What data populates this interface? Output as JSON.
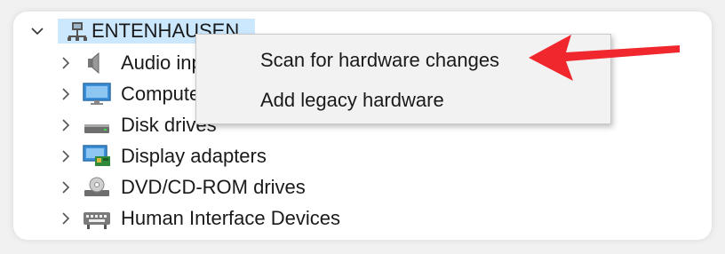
{
  "device_manager": {
    "root": {
      "label": "ENTENHAUSEN",
      "icon": "computer-network-icon",
      "expanded": true
    },
    "categories": [
      {
        "label": "Audio inputs and outputs",
        "icon": "speaker-icon"
      },
      {
        "label": "Computer",
        "icon": "monitor-icon"
      },
      {
        "label": "Disk drives",
        "icon": "disk-drive-icon"
      },
      {
        "label": "Display adapters",
        "icon": "display-adapter-icon"
      },
      {
        "label": "DVD/CD-ROM drives",
        "icon": "dvd-drive-icon"
      },
      {
        "label": "Human Interface Devices",
        "icon": "hid-keyboard-icon"
      }
    ]
  },
  "context_menu": {
    "items": [
      {
        "label": "Scan for hardware changes"
      },
      {
        "label": "Add legacy hardware"
      }
    ]
  },
  "annotation": {
    "arrow_color": "#f0282d",
    "points_to": "Scan for hardware changes"
  },
  "colors": {
    "selection": "#cce8ff",
    "menu_bg": "#f2f2f2"
  }
}
